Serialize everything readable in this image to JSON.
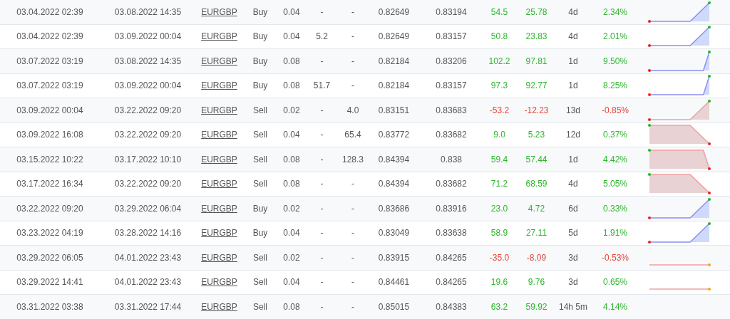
{
  "trades": [
    {
      "open_time": "03.04.2022 02:39",
      "close_time": "03.08.2022 14:35",
      "symbol": "EURGBP",
      "type": "Buy",
      "lots": "0.04",
      "column_6": "-",
      "column_7": "-",
      "open_price": "0.82649",
      "close_price": "0.83194",
      "pips": "54.5",
      "profit": "25.78",
      "duration": "4d",
      "gain": "2.34%",
      "loss": false,
      "sparkline": {
        "kind": "buy-rise"
      }
    },
    {
      "open_time": "03.04.2022 02:39",
      "close_time": "03.09.2022 00:04",
      "symbol": "EURGBP",
      "type": "Buy",
      "lots": "0.04",
      "column_6": "5.2",
      "column_7": "-",
      "open_price": "0.82649",
      "close_price": "0.83157",
      "pips": "50.8",
      "profit": "23.83",
      "duration": "4d",
      "gain": "2.01%",
      "loss": false,
      "sparkline": {
        "kind": "buy-rise"
      }
    },
    {
      "open_time": "03.07.2022 03:19",
      "close_time": "03.08.2022 14:35",
      "symbol": "EURGBP",
      "type": "Buy",
      "lots": "0.08",
      "column_6": "-",
      "column_7": "-",
      "open_price": "0.82184",
      "close_price": "0.83206",
      "pips": "102.2",
      "profit": "97.81",
      "duration": "1d",
      "gain": "9.50%",
      "loss": false,
      "sparkline": {
        "kind": "buy-rise-late"
      }
    },
    {
      "open_time": "03.07.2022 03:19",
      "close_time": "03.09.2022 00:04",
      "symbol": "EURGBP",
      "type": "Buy",
      "lots": "0.08",
      "column_6": "51.7",
      "column_7": "-",
      "open_price": "0.82184",
      "close_price": "0.83157",
      "pips": "97.3",
      "profit": "92.77",
      "duration": "1d",
      "gain": "8.25%",
      "loss": false,
      "sparkline": {
        "kind": "buy-rise-late"
      }
    },
    {
      "open_time": "03.09.2022 00:04",
      "close_time": "03.22.2022 09:20",
      "symbol": "EURGBP",
      "type": "Sell",
      "lots": "0.02",
      "column_6": "-",
      "column_7": "4.0",
      "open_price": "0.83151",
      "close_price": "0.83683",
      "pips": "-53.2",
      "profit": "-12.23",
      "duration": "13d",
      "gain": "-0.85%",
      "loss": true,
      "sparkline": {
        "kind": "sell-rise"
      }
    },
    {
      "open_time": "03.09.2022 16:08",
      "close_time": "03.22.2022 09:20",
      "symbol": "EURGBP",
      "type": "Sell",
      "lots": "0.04",
      "column_6": "-",
      "column_7": "65.4",
      "open_price": "0.83772",
      "close_price": "0.83682",
      "pips": "9.0",
      "profit": "5.23",
      "duration": "12d",
      "gain": "0.37%",
      "loss": false,
      "sparkline": {
        "kind": "sell-fall"
      }
    },
    {
      "open_time": "03.15.2022 10:22",
      "close_time": "03.17.2022 10:10",
      "symbol": "EURGBP",
      "type": "Sell",
      "lots": "0.08",
      "column_6": "-",
      "column_7": "128.3",
      "open_price": "0.84394",
      "close_price": "0.838",
      "pips": "59.4",
      "profit": "57.44",
      "duration": "1d",
      "gain": "4.42%",
      "loss": false,
      "sparkline": {
        "kind": "sell-fall-late"
      }
    },
    {
      "open_time": "03.17.2022 16:34",
      "close_time": "03.22.2022 09:20",
      "symbol": "EURGBP",
      "type": "Sell",
      "lots": "0.08",
      "column_6": "-",
      "column_7": "-",
      "open_price": "0.84394",
      "close_price": "0.83682",
      "pips": "71.2",
      "profit": "68.59",
      "duration": "4d",
      "gain": "5.05%",
      "loss": false,
      "sparkline": {
        "kind": "sell-fall"
      }
    },
    {
      "open_time": "03.22.2022 09:20",
      "close_time": "03.29.2022 06:04",
      "symbol": "EURGBP",
      "type": "Buy",
      "lots": "0.02",
      "column_6": "-",
      "column_7": "-",
      "open_price": "0.83686",
      "close_price": "0.83916",
      "pips": "23.0",
      "profit": "4.72",
      "duration": "6d",
      "gain": "0.33%",
      "loss": false,
      "sparkline": {
        "kind": "buy-rise"
      }
    },
    {
      "open_time": "03.23.2022 04:19",
      "close_time": "03.28.2022 14:16",
      "symbol": "EURGBP",
      "type": "Buy",
      "lots": "0.04",
      "column_6": "-",
      "column_7": "-",
      "open_price": "0.83049",
      "close_price": "0.83638",
      "pips": "58.9",
      "profit": "27.11",
      "duration": "5d",
      "gain": "1.91%",
      "loss": false,
      "sparkline": {
        "kind": "buy-rise"
      }
    },
    {
      "open_time": "03.29.2022 06:05",
      "close_time": "04.01.2022 23:43",
      "symbol": "EURGBP",
      "type": "Sell",
      "lots": "0.02",
      "column_6": "-",
      "column_7": "-",
      "open_price": "0.83915",
      "close_price": "0.84265",
      "pips": "-35.0",
      "profit": "-8.09",
      "duration": "3d",
      "gain": "-0.53%",
      "loss": true,
      "sparkline": {
        "kind": "sell-flat"
      }
    },
    {
      "open_time": "03.29.2022 14:41",
      "close_time": "04.01.2022 23:43",
      "symbol": "EURGBP",
      "type": "Sell",
      "lots": "0.04",
      "column_6": "-",
      "column_7": "-",
      "open_price": "0.84461",
      "close_price": "0.84265",
      "pips": "19.6",
      "profit": "9.76",
      "duration": "3d",
      "gain": "0.65%",
      "loss": false,
      "sparkline": {
        "kind": "sell-flat"
      }
    },
    {
      "open_time": "03.31.2022 03:38",
      "close_time": "03.31.2022 17:44",
      "symbol": "EURGBP",
      "type": "Sell",
      "lots": "0.08",
      "column_6": "-",
      "column_7": "-",
      "open_price": "0.85015",
      "close_price": "0.84383",
      "pips": "63.2",
      "profit": "59.92",
      "duration": "14h 5m",
      "gain": "4.14%",
      "loss": false
    }
  ]
}
